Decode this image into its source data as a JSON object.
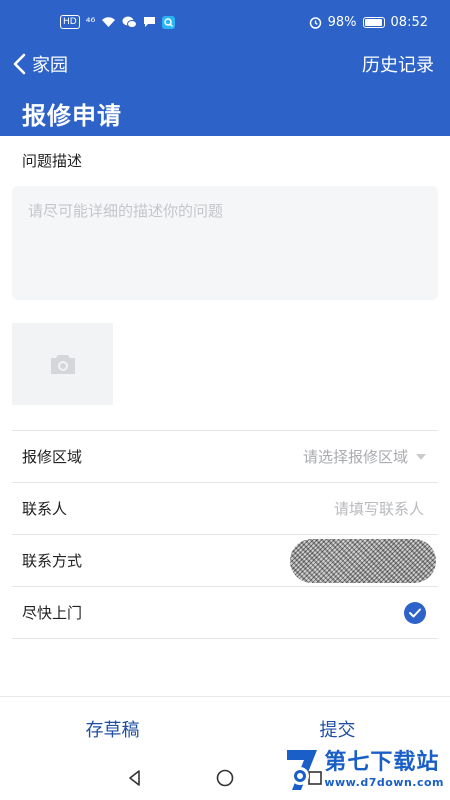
{
  "status_bar": {
    "chip": "HD",
    "network": "⁴⁶",
    "battery_percent": "98%",
    "battery_level": 0.98,
    "time": "08:52"
  },
  "nav": {
    "back_label": "家园",
    "history_label": "历史记录"
  },
  "page_title": "报修申请",
  "form": {
    "desc_label": "问题描述",
    "desc_placeholder": "请尽可能详细的描述你的问题",
    "area_label": "报修区域",
    "area_placeholder": "请选择报修区域",
    "contact_label": "联系人",
    "contact_placeholder": "请填写联系人",
    "phone_label": "联系方式",
    "asap_label": "尽快上门",
    "asap_checked": true
  },
  "actions": {
    "draft_label": "存草稿",
    "submit_label": "提交"
  },
  "watermark": {
    "title": "第七下载站",
    "url": "www.d7down.com"
  },
  "colors": {
    "primary": "#2d63c8",
    "button_text": "#1f4fa3"
  }
}
